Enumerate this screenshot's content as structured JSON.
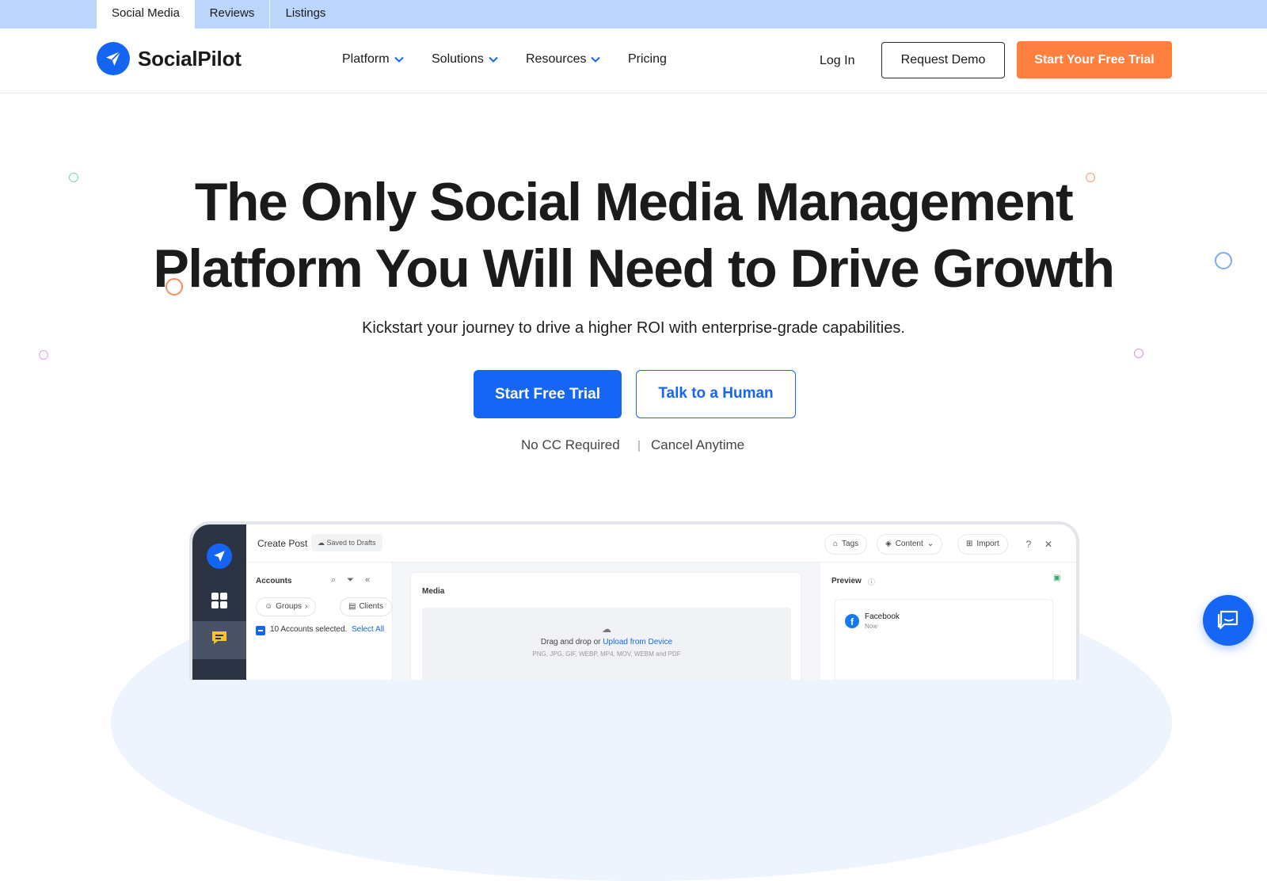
{
  "top_tabs": [
    {
      "label": "Social Media",
      "active": true
    },
    {
      "label": "Reviews",
      "active": false
    },
    {
      "label": "Listings",
      "active": false
    }
  ],
  "brand": {
    "name": "SocialPilot",
    "color": "#1565f5",
    "icon": "paper-plane-icon"
  },
  "nav": {
    "items": [
      {
        "label": "Platform",
        "has_dropdown": true
      },
      {
        "label": "Solutions",
        "has_dropdown": true
      },
      {
        "label": "Resources",
        "has_dropdown": true
      },
      {
        "label": "Pricing",
        "has_dropdown": false
      }
    ],
    "login": "Log In",
    "request_demo": "Request Demo",
    "free_trial": "Start Your Free Trial"
  },
  "hero": {
    "title_line1": "The Only Social Media Management",
    "title_line2": "Platform You Will Need to Drive Growth",
    "subtitle": "Kickstart your journey to drive a higher ROI with enterprise-grade capabilities.",
    "primary_cta": "Start Free Trial",
    "secondary_cta": "Talk to a Human",
    "note_left": "No CC Required",
    "note_sep": "|",
    "note_right": "Cancel Anytime"
  },
  "app_preview": {
    "header_title": "Create Post",
    "saved_badge": "Saved to Drafts",
    "tags": "Tags",
    "content": "Content",
    "import": "Import",
    "accounts_title": "Accounts",
    "groups_chip": "Groups",
    "clients_chip": "Clients",
    "accounts_selected": "10 Accounts selected.",
    "select_all": "Select All",
    "media_title": "Media",
    "drop_text": "Drag and drop or",
    "upload_link": "Upload from Device",
    "formats": "PNG, JPG, GIF, WEBP, MP4, MOV, WEBM and PDF",
    "preview_title": "Preview",
    "preview_network": "Facebook",
    "preview_time": "Now"
  },
  "colors": {
    "primary": "#1566f5",
    "accent_orange": "#ff7f3e",
    "topbar_bg": "#bcd6fb"
  }
}
